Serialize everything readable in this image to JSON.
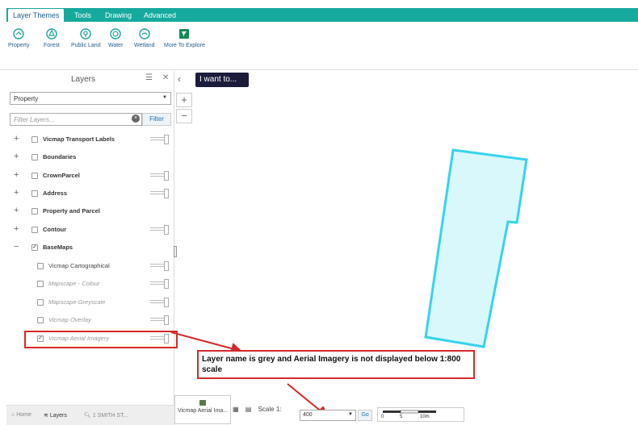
{
  "ribbon": {
    "tabs": [
      "Layer Themes",
      "Tools",
      "Drawing",
      "Advanced"
    ],
    "tools": [
      "Property",
      "Forest",
      "Public Land",
      "Water",
      "Wetland",
      "More To Explore"
    ]
  },
  "layers_panel": {
    "title": "Layers",
    "theme_select": "Property",
    "filter_placeholder": "Filter Layers...",
    "filter_button": "Filter",
    "items": [
      {
        "label": "Vicmap Transport Labels",
        "expander": "+",
        "checked": false
      },
      {
        "label": "Boundaries",
        "expander": "+",
        "checked": false
      },
      {
        "label": "CrownParcel",
        "expander": "+",
        "checked": false
      },
      {
        "label": "Address",
        "expander": "+",
        "checked": false
      },
      {
        "label": "Property and Parcel",
        "expander": "+",
        "checked": false
      },
      {
        "label": "Contour",
        "expander": "+",
        "checked": false
      },
      {
        "label": "BaseMaps",
        "expander": "−",
        "checked": true
      }
    ],
    "basemaps": [
      {
        "label": "Vicmap Cartographical",
        "checked": false
      },
      {
        "label": "Mapscape - Colour",
        "checked": false
      },
      {
        "label": "Mapscape Greyscale",
        "checked": false
      },
      {
        "label": "Vicmap Overlay",
        "checked": false
      },
      {
        "label": "Vicmap Aerial Imagery",
        "checked": true
      }
    ],
    "bottom_tabs": [
      "Home",
      "Layers",
      "1 SMITH ST..."
    ]
  },
  "map": {
    "i_want_to": "I want to...",
    "zoom_in": "+",
    "zoom_out": "−",
    "callout": "Layer name is grey and Aerial Imagery is not displayed below 1:800 scale",
    "basemap_label": "Vicmap Aerial Ima...",
    "scale_label": "Scale 1:",
    "scale_value": "400",
    "go": "Go",
    "scalebar_ticks": [
      "0",
      "5",
      "10m"
    ],
    "colors": {
      "parcel_stroke": "#35d3f0",
      "parcel_fill": "#d9f8fc",
      "annotation": "#d42a2a",
      "ribbon": "#16a99e"
    }
  }
}
